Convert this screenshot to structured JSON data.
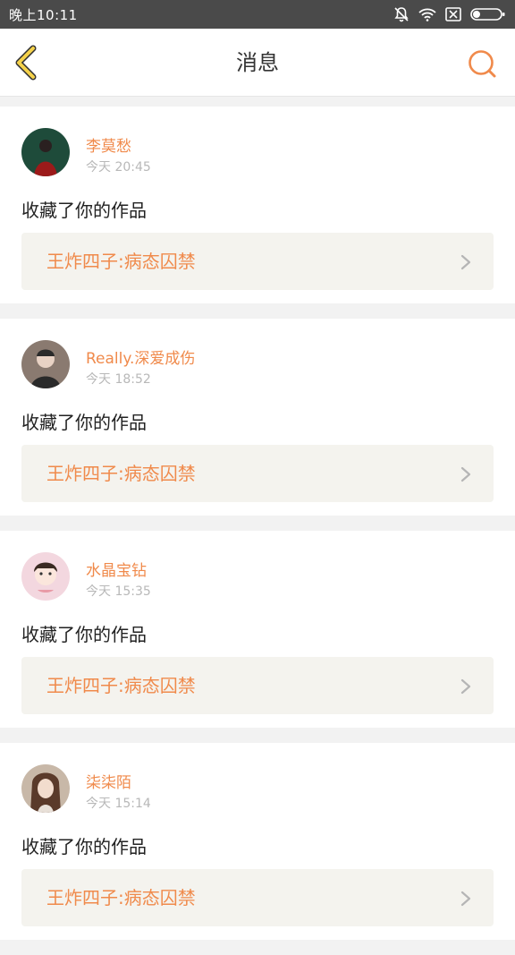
{
  "status_bar": {
    "time": "晚上10:11",
    "icons": [
      "bell-off-icon",
      "wifi-icon",
      "sim-off-icon",
      "battery-icon"
    ]
  },
  "header": {
    "title": "消息",
    "back_icon": "chevron-left-icon",
    "search_icon": "search-icon"
  },
  "colors": {
    "accent": "#f08a4b",
    "back_icon": "#f5d24a",
    "background": "#f2f2f2",
    "card_link_bg": "#f4f3ee"
  },
  "messages": [
    {
      "user": "李莫愁",
      "time": "今天 20:45",
      "action": "收藏了你的作品",
      "work": "王炸四子:病态囚禁",
      "avatar_colors": [
        "#1e4b3a",
        "#9c1a1a"
      ]
    },
    {
      "user": "Really.深爱成伤",
      "time": "今天 18:52",
      "action": "收藏了你的作品",
      "work": "王炸四子:病态囚禁",
      "avatar_colors": [
        "#8a7a70",
        "#2a2a2a"
      ]
    },
    {
      "user": "水晶宝钻",
      "time": "今天 15:35",
      "action": "收藏了你的作品",
      "work": "王炸四子:病态囚禁",
      "avatar_colors": [
        "#f3d7df",
        "#e89aa6"
      ]
    },
    {
      "user": "柒柒陌",
      "time": "今天 15:14",
      "action": "收藏了你的作品",
      "work": "王炸四子:病态囚禁",
      "avatar_colors": [
        "#c8b8a8",
        "#5a3a2a"
      ]
    }
  ]
}
